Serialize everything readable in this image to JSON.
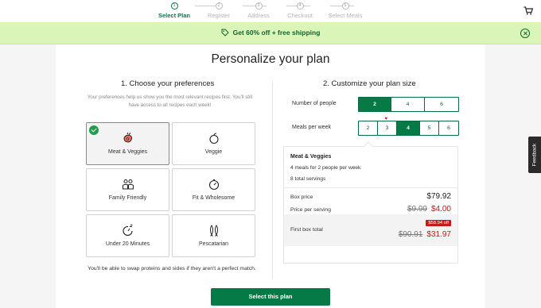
{
  "stepper": {
    "steps": [
      {
        "num": "1",
        "label": "Select Plan",
        "active": true
      },
      {
        "num": "2",
        "label": "Register",
        "active": false
      },
      {
        "num": "3",
        "label": "Address",
        "active": false
      },
      {
        "num": "4",
        "label": "Checkout",
        "active": false
      },
      {
        "num": "5",
        "label": "Select Meals",
        "active": false
      }
    ]
  },
  "promo": {
    "text": "Get 60% off + free shipping"
  },
  "page": {
    "title": "Personalize your plan",
    "left_heading": "1. Choose your preferences",
    "right_heading": "2. Customize your plan size",
    "pref_description": "Your preferences help us show you the most relevant recipes first. You'll still have access to all recipes each week!",
    "swap_note": "You'll be able to swap proteins and sides if they aren't a perfect match.",
    "cta_label": "Select this plan"
  },
  "preferences": [
    {
      "label": "Meat & Veggies",
      "icon": "meat-veggies-icon",
      "selected": true
    },
    {
      "label": "Veggie",
      "icon": "veggie-icon",
      "selected": false
    },
    {
      "label": "Family Friendly",
      "icon": "family-icon",
      "selected": false
    },
    {
      "label": "Fit & Wholesome",
      "icon": "fit-wholesome-icon",
      "selected": false
    },
    {
      "label": "Under 20 Minutes",
      "icon": "timer-icon",
      "selected": false
    },
    {
      "label": "Pescatarian",
      "icon": "fish-icon",
      "selected": false
    }
  ],
  "plan_size": {
    "people_label": "Number of people",
    "people_options": [
      "2",
      "4",
      "6"
    ],
    "people_selected": "2",
    "meals_label": "Meals per week",
    "meals_options": [
      "2",
      "3",
      "4",
      "5",
      "6"
    ],
    "meals_selected": "4",
    "meals_heart": "3"
  },
  "summary": {
    "title": "Meat & Veggies",
    "meals_line": "4 meals for 2 people per week",
    "servings_line": "8 total servings",
    "box_price_label": "Box price",
    "box_price": "$79.92",
    "per_serving_label": "Price per serving",
    "per_serving_old": "$9.99",
    "per_serving_new": "$4.00",
    "first_box_label": "First box total",
    "discount_badge": "$58.94 off",
    "first_box_old": "$90.91",
    "first_box_new": "$31.97"
  },
  "feedback_label": "Feedback",
  "colors": {
    "brand_green": "#067a46",
    "promo_bg": "#d9f5b7",
    "sale_red": "#c21d1d"
  }
}
